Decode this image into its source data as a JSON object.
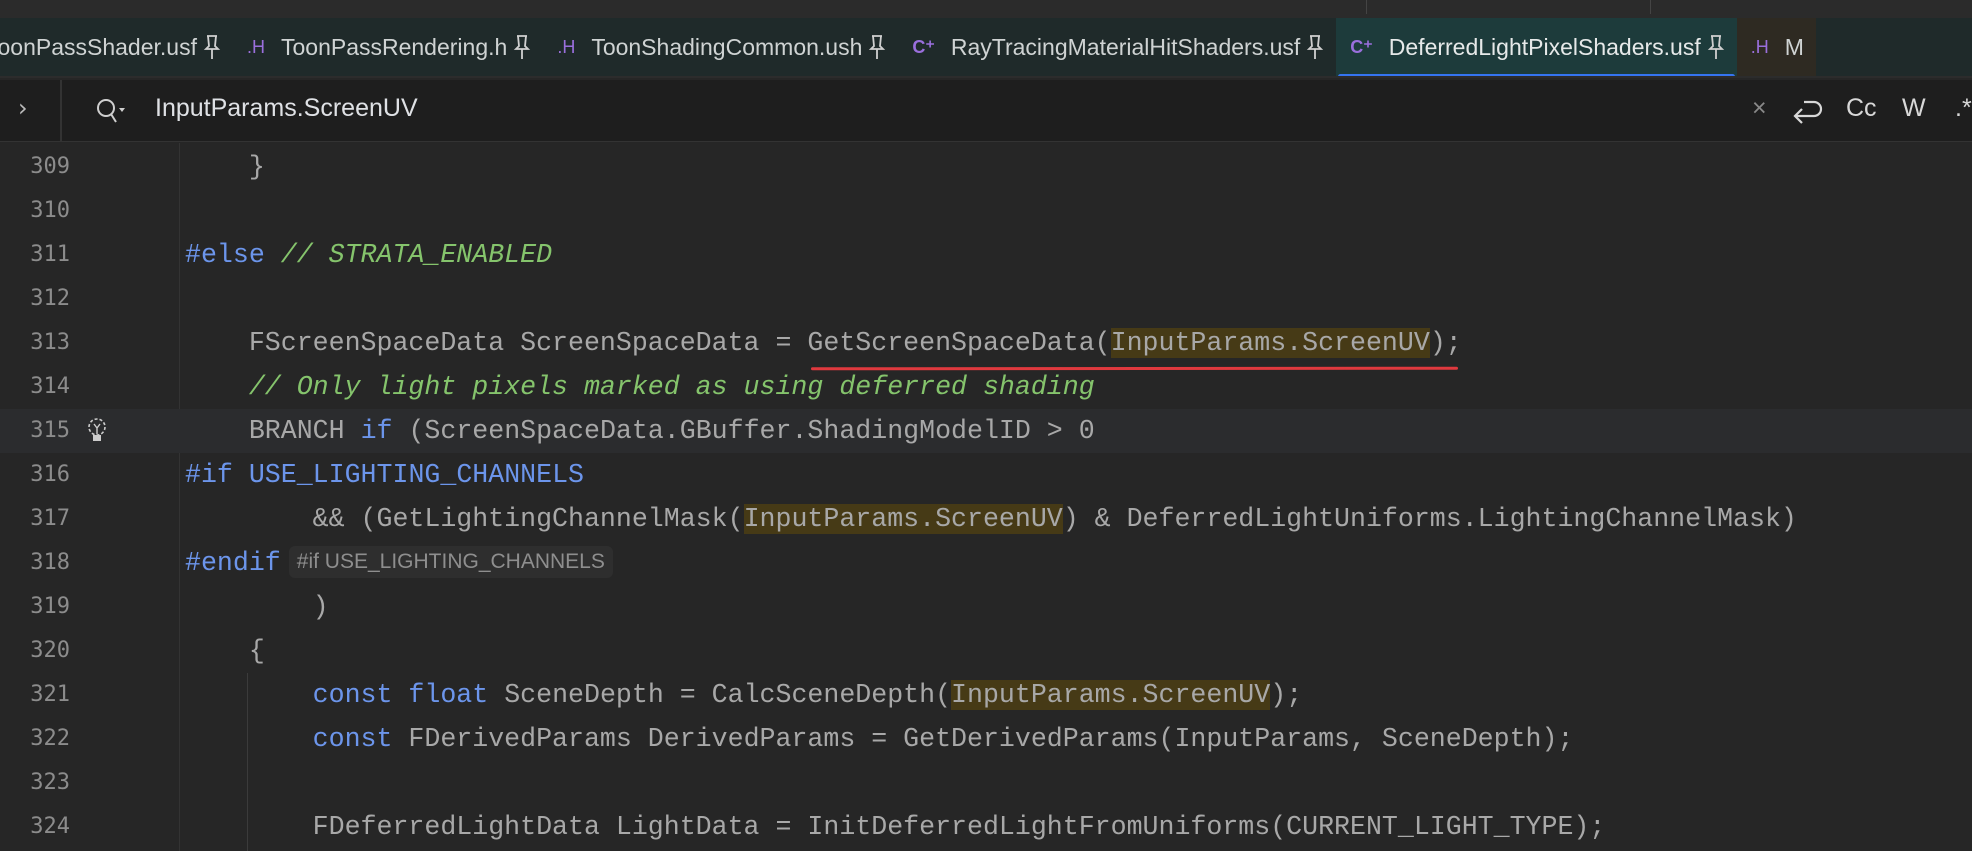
{
  "tabs": [
    {
      "type": "",
      "name": "ToonPassShader.usf",
      "pinned": true
    },
    {
      "type": ".H",
      "name": "ToonPassRendering.h",
      "pinned": true
    },
    {
      "type": ".H",
      "name": "ToonShadingCommon.ush",
      "pinned": true
    },
    {
      "type": "C⁺",
      "name": "RayTracingMaterialHitShaders.usf",
      "pinned": true
    },
    {
      "type": "C⁺",
      "name": "DeferredLightPixelShaders.usf",
      "pinned": true,
      "active": true
    },
    {
      "type": ".H",
      "name": "M",
      "pinned": false
    }
  ],
  "search": {
    "query": "InputParams.ScreenUV",
    "icons": [
      "close-icon",
      "wrap-icon",
      "match-case-icon",
      "whole-word-icon",
      "regex-icon"
    ],
    "labels": {
      "close": "×",
      "match_case": "Cc",
      "whole_word": "W",
      "regex": ".*"
    }
  },
  "colors": {
    "accent": "#3574f0",
    "keyword": "#6c95eb",
    "comment": "#85c46c",
    "match_highlight": "#463a16",
    "error": "#e0393e"
  },
  "editor": {
    "current_line": 315,
    "lines": [
      {
        "n": "309",
        "tokens": [
          {
            "t": "    }",
            "c": ""
          }
        ]
      },
      {
        "n": "310",
        "tokens": []
      },
      {
        "n": "311",
        "tokens": [
          {
            "t": "#else",
            "c": "pp"
          },
          {
            "t": " // STRATA_ENABLED",
            "c": "cm"
          }
        ]
      },
      {
        "n": "312",
        "tokens": []
      },
      {
        "n": "313",
        "tokens": [
          {
            "t": "    FScreenSpaceData ScreenSpaceData = GetScreenSpaceData(",
            "c": ""
          },
          {
            "t": "InputParams.ScreenUV",
            "c": "hl"
          },
          {
            "t": ");",
            "c": ""
          }
        ]
      },
      {
        "n": "314",
        "tokens": [
          {
            "t": "    // Only light pixels marked as using deferred shading",
            "c": "cm"
          }
        ]
      },
      {
        "n": "315",
        "tokens": [
          {
            "t": "    BRANCH ",
            "c": ""
          },
          {
            "t": "if",
            "c": "kw"
          },
          {
            "t": " (ScreenSpaceData.GBuffer.ShadingModelID > 0",
            "c": ""
          }
        ]
      },
      {
        "n": "316",
        "tokens": [
          {
            "t": "#if",
            "c": "pp"
          },
          {
            "t": " USE_LIGHTING_CHANNELS",
            "c": "pp"
          }
        ]
      },
      {
        "n": "317",
        "tokens": [
          {
            "t": "        && (GetLightingChannelMask(",
            "c": ""
          },
          {
            "t": "InputParams.ScreenUV",
            "c": "hl"
          },
          {
            "t": ") & DeferredLightUniforms.LightingChannelMask)",
            "c": ""
          }
        ]
      },
      {
        "n": "318",
        "tokens": [
          {
            "t": "#endif",
            "c": "pp"
          }
        ],
        "hint": "#if USE_LIGHTING_CHANNELS"
      },
      {
        "n": "319",
        "tokens": [
          {
            "t": "        )",
            "c": ""
          }
        ]
      },
      {
        "n": "320",
        "tokens": [
          {
            "t": "    {",
            "c": ""
          }
        ]
      },
      {
        "n": "321",
        "tokens": [
          {
            "t": "        ",
            "c": ""
          },
          {
            "t": "const float",
            "c": "kw"
          },
          {
            "t": " SceneDepth = CalcSceneDepth(",
            "c": ""
          },
          {
            "t": "InputParams.ScreenUV",
            "c": "hl"
          },
          {
            "t": ");",
            "c": ""
          }
        ]
      },
      {
        "n": "322",
        "tokens": [
          {
            "t": "        ",
            "c": ""
          },
          {
            "t": "const",
            "c": "kw"
          },
          {
            "t": " FDerivedParams DerivedParams = GetDerivedParams(InputParams, SceneDepth);",
            "c": ""
          }
        ]
      },
      {
        "n": "323",
        "tokens": []
      },
      {
        "n": "324",
        "tokens": [
          {
            "t": "        FDeferredLightData LightData = InitDeferredLightFromUniforms(CURRENT_LIGHT_TYPE);",
            "c": ""
          }
        ]
      }
    ]
  }
}
